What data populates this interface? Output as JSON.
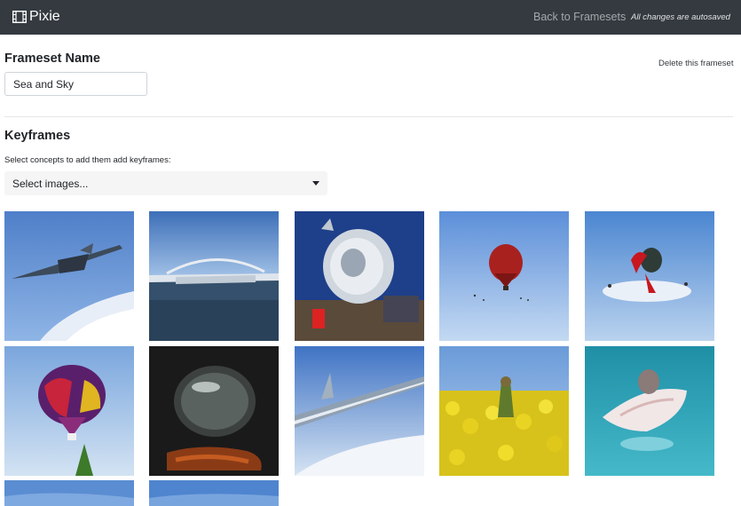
{
  "navbar": {
    "brand": "Pixie",
    "brand_icon": "film-icon",
    "back_link": "Back to Framesets",
    "autosave_note": "All changes are autosaved"
  },
  "frameset": {
    "heading": "Frameset Name",
    "name_value": "Sea and Sky",
    "delete_link": "Delete this frameset"
  },
  "keyframes": {
    "heading": "Keyframes",
    "help_text": "Select concepts to add them add keyframes:",
    "select_placeholder": "Select images..."
  },
  "images": [
    "jet-plane-over-clouds",
    "bridge-over-sea",
    "satellite-dish-machine",
    "red-hot-air-balloon",
    "red-bird-in-sky",
    "purple-hot-air-balloon",
    "glass-bubble-dark",
    "aircraft-wing-in-sky",
    "yellow-flower-field",
    "shell-in-turquoise-water",
    "sky-partial",
    "sky-partial"
  ]
}
